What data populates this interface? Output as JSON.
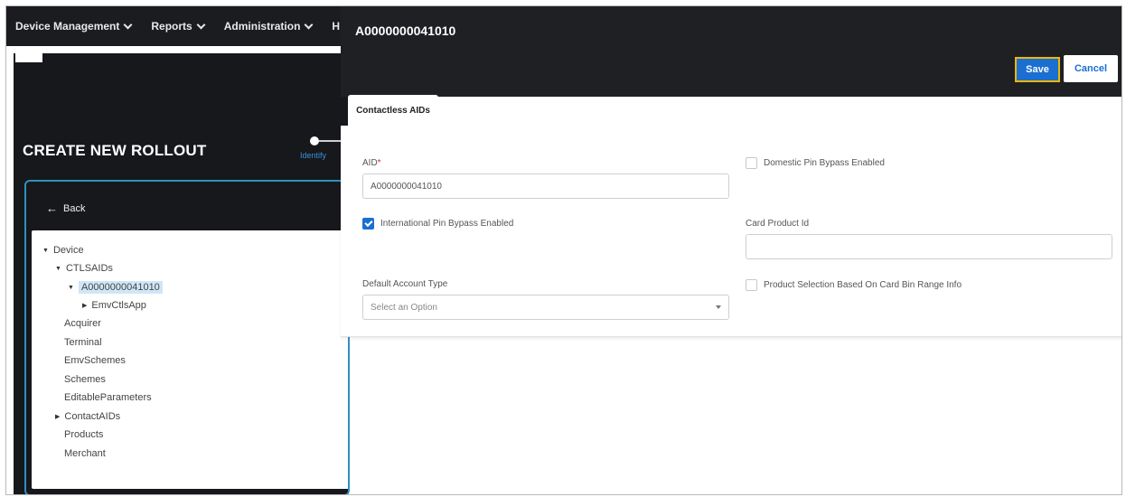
{
  "nav": {
    "items": [
      {
        "label": "Device Management"
      },
      {
        "label": "Reports"
      },
      {
        "label": "Administration"
      },
      {
        "label": "H"
      }
    ]
  },
  "wizard": {
    "title": "CREATE NEW ROLLOUT",
    "step_label": "Identify",
    "back_label": "Back"
  },
  "tree": {
    "device": "Device",
    "ctlsaids": "CTLSAIDs",
    "aid": "A0000000041010",
    "emvctlsapp": "EmvCtlsApp",
    "acquirer": "Acquirer",
    "terminal": "Terminal",
    "emvschemes": "EmvSchemes",
    "schemes": "Schemes",
    "editable": "EditableParameters",
    "contactaids": "ContactAIDs",
    "products": "Products",
    "merchant": "Merchant"
  },
  "detail": {
    "title": "A0000000041010",
    "save_label": "Save",
    "cancel_label": "Cancel",
    "tab_label": "Contactless AIDs",
    "aid_label": "AID",
    "aid_required": "*",
    "aid_value": "A0000000041010",
    "intl_pin_label": "International Pin Bypass Enabled",
    "intl_pin_checked": true,
    "default_account_label": "Default Account Type",
    "default_account_placeholder": "Select an Option",
    "domestic_pin_label": "Domestic Pin Bypass Enabled",
    "domestic_pin_checked": false,
    "card_product_label": "Card Product Id",
    "card_product_value": "",
    "product_selection_label": "Product Selection Based On Card Bin Range Info",
    "product_selection_checked": false
  },
  "colors": {
    "accent": "#1a6fd1",
    "highlight": "#f2b600",
    "dark_bg": "#1e2024",
    "tree_border": "#2f8fbf"
  }
}
